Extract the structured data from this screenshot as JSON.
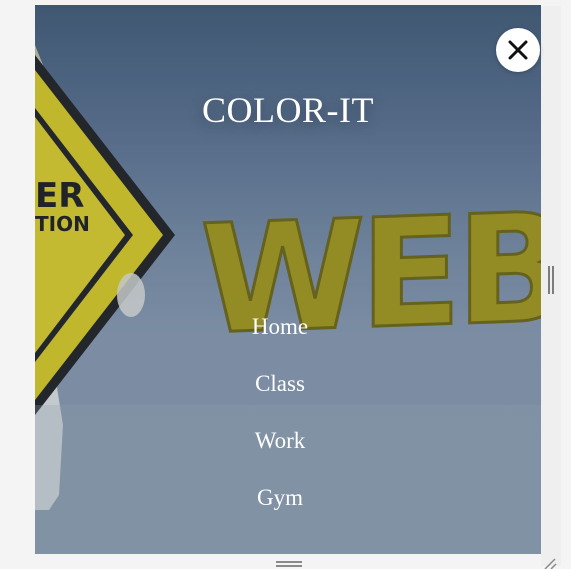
{
  "brand": {
    "title": "COLOR-IT"
  },
  "background": {
    "sign_text_line1": "ER",
    "sign_text_line2": "TION",
    "banner_text": "WEBSI"
  },
  "nav": {
    "items": [
      {
        "label": "Home"
      },
      {
        "label": "Class"
      },
      {
        "label": "Work"
      },
      {
        "label": "Gym"
      }
    ]
  },
  "close": {
    "icon": "close-icon"
  },
  "colors": {
    "overlay": "#5b7292",
    "text": "#ffffff",
    "banner_yellow": "#a89a10",
    "sign_yellow": "#e2d21a"
  }
}
